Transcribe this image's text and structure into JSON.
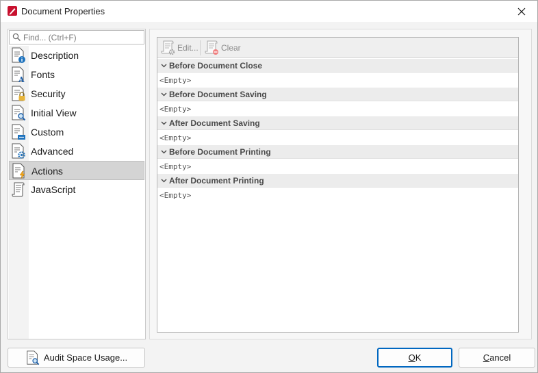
{
  "window": {
    "title": "Document Properties"
  },
  "search": {
    "placeholder": "Find... (Ctrl+F)",
    "value": ""
  },
  "sidebar": {
    "items": [
      {
        "label": "Description",
        "icon": "description-doc-icon",
        "selected": false
      },
      {
        "label": "Fonts",
        "icon": "fonts-doc-icon",
        "selected": false
      },
      {
        "label": "Security",
        "icon": "security-doc-icon",
        "selected": false
      },
      {
        "label": "Initial View",
        "icon": "initial-view-doc-icon",
        "selected": false
      },
      {
        "label": "Custom",
        "icon": "custom-doc-icon",
        "selected": false
      },
      {
        "label": "Advanced",
        "icon": "advanced-doc-icon",
        "selected": false
      },
      {
        "label": "Actions",
        "icon": "actions-doc-icon",
        "selected": true
      },
      {
        "label": "JavaScript",
        "icon": "javascript-scroll-icon",
        "selected": false
      }
    ]
  },
  "toolbar": {
    "edit_label": "Edit...",
    "clear_label": "Clear"
  },
  "sections": [
    {
      "title": "Before Document Close",
      "value": "<Empty>"
    },
    {
      "title": "Before Document Saving",
      "value": "<Empty>"
    },
    {
      "title": "After Document Saving",
      "value": "<Empty>"
    },
    {
      "title": "Before Document Printing",
      "value": "<Empty>"
    },
    {
      "title": "After Document Printing",
      "value": "<Empty>"
    }
  ],
  "footer": {
    "audit_label": "Audit Space Usage...",
    "ok_label": "OK",
    "cancel_label": "Cancel"
  },
  "colors": {
    "accent": "#0067c0",
    "selected_row": "#d4d4d4",
    "app_icon": "#c8102e"
  }
}
